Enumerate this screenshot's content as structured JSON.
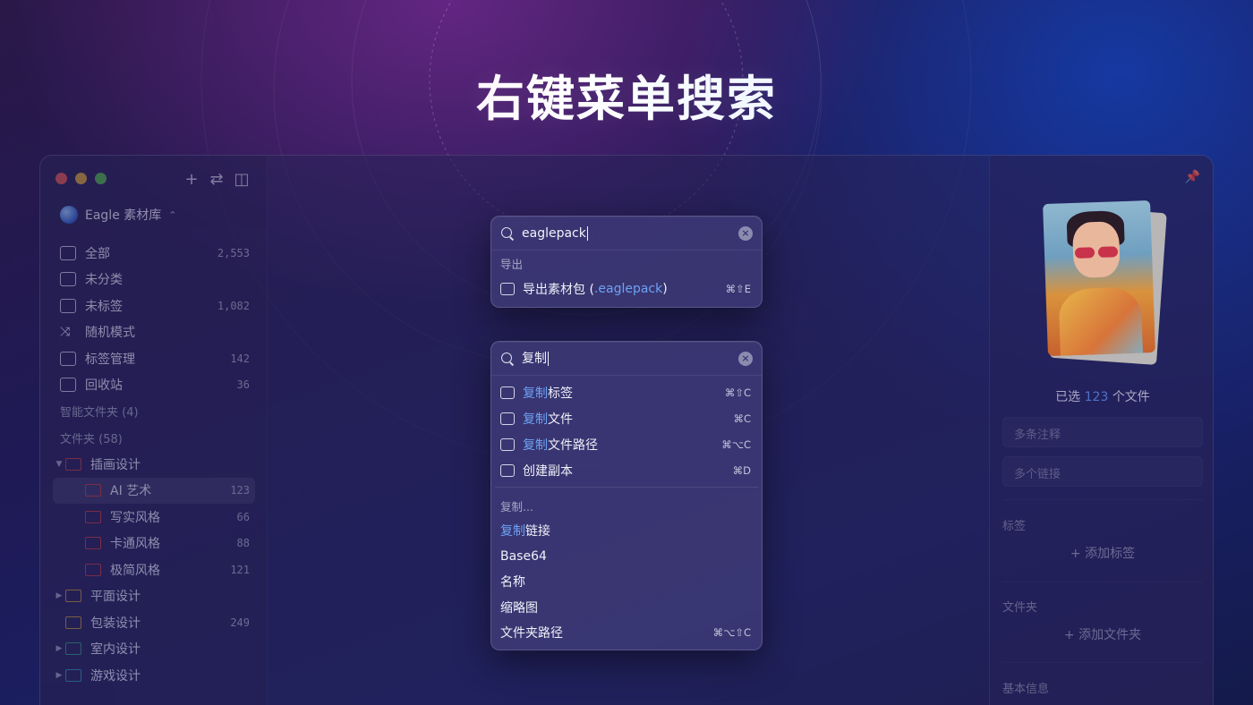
{
  "headline": "右键菜单搜索",
  "window": {
    "library_name": "Eagle 素材库",
    "nav": [
      {
        "label": "全部",
        "count": "2,553",
        "icon": "inbox-icon"
      },
      {
        "label": "未分类",
        "count": "",
        "icon": "folder-outline-icon"
      },
      {
        "label": "未标签",
        "count": "1,082",
        "icon": "tag-outline-icon"
      },
      {
        "label": "随机模式",
        "count": "",
        "icon": "shuffle-icon"
      },
      {
        "label": "标签管理",
        "count": "142",
        "icon": "bookmark-icon"
      },
      {
        "label": "回收站",
        "count": "36",
        "icon": "trash-icon"
      }
    ],
    "smart_folders_label": "智能文件夹 (4)",
    "folders_label": "文件夹 (58)",
    "folders": [
      {
        "label": "插画设计",
        "count": "",
        "color": "#c23a3a",
        "child": false,
        "expanded": true
      },
      {
        "label": "AI 艺术",
        "count": "123",
        "color": "#c23a3a",
        "child": true,
        "active": true
      },
      {
        "label": "写实风格",
        "count": "66",
        "color": "#c23a3a",
        "child": true
      },
      {
        "label": "卡通风格",
        "count": "88",
        "color": "#c23a3a",
        "child": true
      },
      {
        "label": "极简风格",
        "count": "121",
        "color": "#c23a3a",
        "child": true
      },
      {
        "label": "平面设计",
        "count": "",
        "color": "#c0912e",
        "child": false
      },
      {
        "label": "包装设计",
        "count": "249",
        "color": "#c0912e",
        "child": false
      },
      {
        "label": "室内设计",
        "count": "",
        "color": "#2f9a78",
        "child": false
      },
      {
        "label": "游戏设计",
        "count": "",
        "color": "#2f8fb0",
        "child": false
      }
    ]
  },
  "right_panel": {
    "selected_prefix": "已选",
    "selected_count": "123",
    "selected_suffix": "个文件",
    "annotation_placeholder": "多条注释",
    "links_placeholder": "多个链接",
    "tags_label": "标签",
    "add_tag": "添加标签",
    "folders_label": "文件夹",
    "add_folder": "添加文件夹",
    "basic_info_label": "基本信息"
  },
  "popup1": {
    "query": "eaglepack",
    "group": "导出",
    "items": [
      {
        "prefix": "导出素材包 (",
        "highlight": ".eaglepack",
        "suffix": ")",
        "shortcut": "⌘⇧E",
        "icon": "package-icon"
      }
    ]
  },
  "popup2": {
    "query": "复制",
    "items": [
      {
        "highlight": "复制",
        "suffix": "标签",
        "shortcut": "⌘⇧C",
        "icon": "tag-icon"
      },
      {
        "highlight": "复制",
        "suffix": "文件",
        "shortcut": "⌘C",
        "icon": "file-icon"
      },
      {
        "highlight": "复制",
        "suffix": "文件路径",
        "shortcut": "⌘⌥C",
        "icon": "terminal-icon"
      },
      {
        "highlight": "",
        "suffix": "创建副本",
        "shortcut": "⌘D",
        "icon": "duplicate-icon"
      }
    ],
    "group": "复制...",
    "sub_items": [
      {
        "highlight": "复制",
        "suffix": "链接",
        "shortcut": ""
      },
      {
        "highlight": "",
        "suffix": "Base64",
        "shortcut": ""
      },
      {
        "highlight": "",
        "suffix": "名称",
        "shortcut": ""
      },
      {
        "highlight": "",
        "suffix": "缩略图",
        "shortcut": ""
      },
      {
        "highlight": "",
        "suffix": "文件夹路径",
        "shortcut": "⌘⌥⇧C"
      }
    ]
  },
  "colors": {
    "highlight": "#6ea2f4",
    "close": "#e0574f",
    "minimize": "#d7a436",
    "maximize": "#4fb34a"
  }
}
